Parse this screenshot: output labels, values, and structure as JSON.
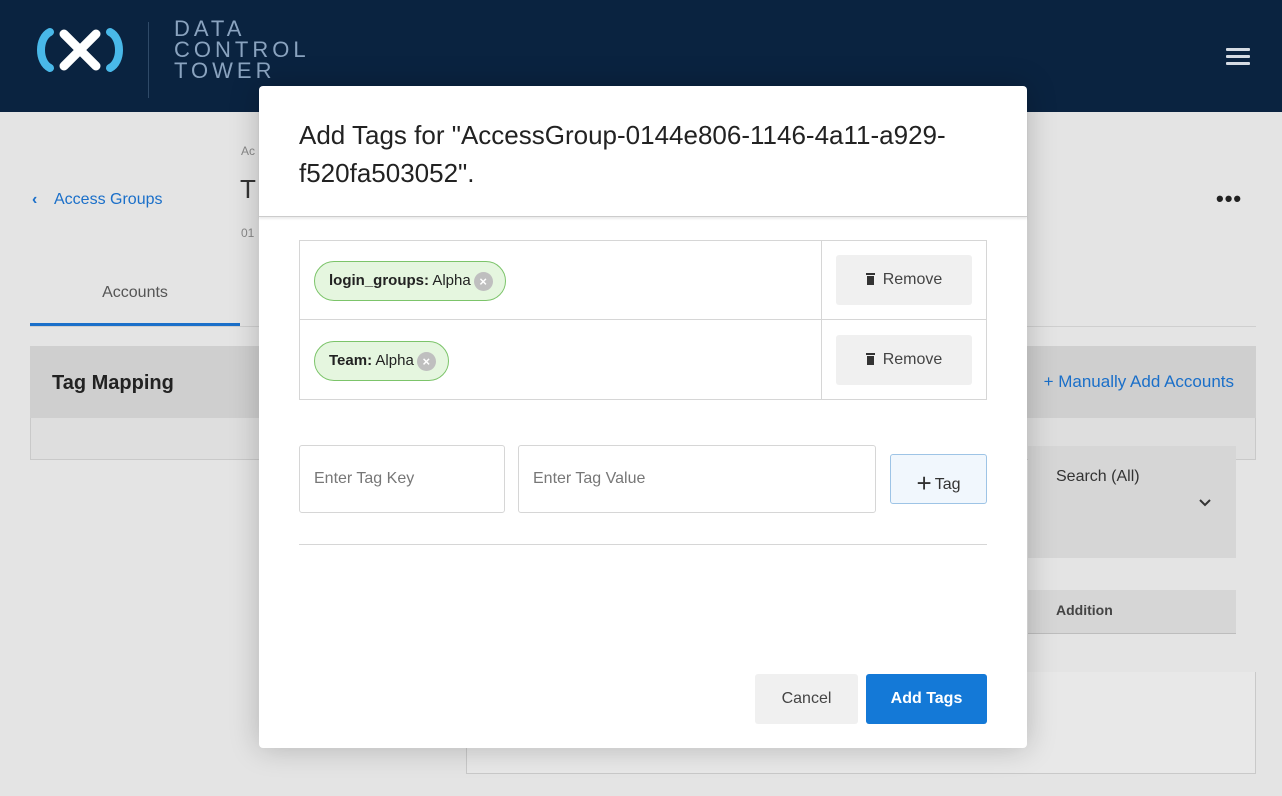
{
  "brand": {
    "logo_lines": [
      "DATA",
      "CONTROL",
      "TOWER"
    ],
    "colors": {
      "header_bg": "#0a2340",
      "accent": "#1479d7",
      "chip_border": "#7cc46a",
      "chip_bg": "#e5f6df"
    }
  },
  "header": {
    "menu_icon": "hamburger-icon"
  },
  "page": {
    "back_label": "Access Groups",
    "breadcrumb_peek": "Ac",
    "title_peek": "T",
    "subtitle_peek": "01",
    "more_label": "•••",
    "tabs": [
      {
        "label": "Accounts",
        "active": true
      }
    ],
    "panel": {
      "title": "Tag Mapping",
      "action_label": "+ Manually Add Accounts",
      "search_label": "Search (All)",
      "column_header": "Addition"
    }
  },
  "modal": {
    "title": "Add Tags for \"AccessGroup-0144e806-1146-4a11-a929-f520fa503052\".",
    "tags": [
      {
        "key": "login_groups:",
        "value": "Alpha",
        "remove_label": "Remove"
      },
      {
        "key": "Team:",
        "value": "Alpha",
        "remove_label": "Remove"
      }
    ],
    "tag_key_placeholder": "Enter Tag Key",
    "tag_value_placeholder": "Enter Tag Value",
    "add_tag_plus": "+",
    "add_tag_label": "Tag",
    "cancel_label": "Cancel",
    "submit_label": "Add Tags"
  }
}
